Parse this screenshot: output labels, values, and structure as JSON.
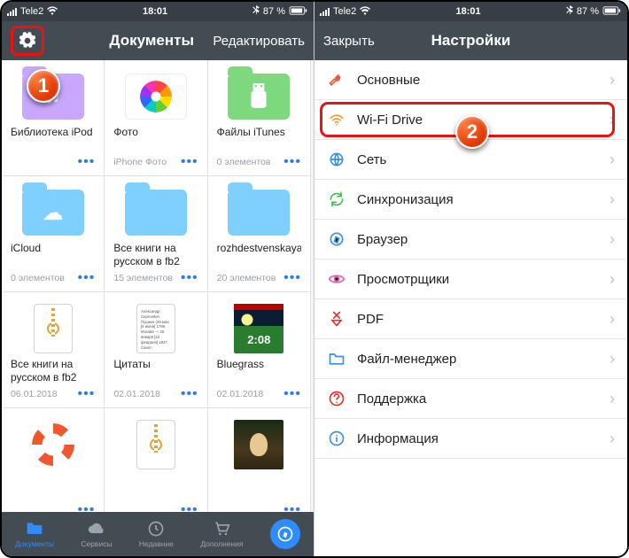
{
  "status": {
    "carrier": "Tele2",
    "time": "18:01",
    "right": "87 %"
  },
  "left_nav": {
    "title": "Документы",
    "edit": "Редактировать"
  },
  "docs": [
    {
      "title": "Библиотека iPod",
      "meta": "",
      "kind": "folder",
      "color": "#c9a7ff",
      "icon": "♫"
    },
    {
      "title": "Фото",
      "meta": "iPhone Фото",
      "kind": "photos"
    },
    {
      "title": "Файлы iTunes",
      "meta": "0 элементов",
      "kind": "folder",
      "color": "#7ed97e",
      "icon": "usb"
    },
    {
      "title": "iCloud",
      "meta": "0 элементов",
      "kind": "folder",
      "color": "#7fd0ff",
      "icon": "☁"
    },
    {
      "title": "Все книги на русском в fb2",
      "meta": "15 элементов",
      "kind": "folder",
      "color": "#7fd0ff",
      "icon": ""
    },
    {
      "title": "rozhdestvenskaya_m...ev.net)",
      "meta": "20 элементов",
      "kind": "folder",
      "color": "#7fd0ff",
      "icon": ""
    },
    {
      "title": "Все книги на русском в fb2",
      "meta": "06.01.2018",
      "kind": "zip"
    },
    {
      "title": "Цитаты",
      "meta": "02.01.2018",
      "kind": "doc",
      "text": "Александр Сергеевич Пушкин (26 мая [6 июня] 1799, Москва — 29 января [10 февраля] 1837, Санкт-"
    },
    {
      "title": "Bluegrass",
      "meta": "02.01.2018",
      "kind": "bluegrass",
      "big": "2:08"
    },
    {
      "title": "",
      "meta": "",
      "kind": "lifebuoy"
    },
    {
      "title": "",
      "meta": "",
      "kind": "zip"
    },
    {
      "title": "",
      "meta": "",
      "kind": "mona"
    }
  ],
  "tabs": [
    {
      "label": "Документы",
      "icon": "folder",
      "active": true
    },
    {
      "label": "Сервисы",
      "icon": "cloud"
    },
    {
      "label": "Недавние",
      "icon": "clock"
    },
    {
      "label": "Дополнения",
      "icon": "cart"
    },
    {
      "label": "",
      "icon": "compass",
      "compass": true
    }
  ],
  "right_nav": {
    "close": "Закрыть",
    "title": "Настройки"
  },
  "settings": [
    {
      "label": "Основные",
      "icon": "wrench",
      "color": "#f0572e"
    },
    {
      "label": "Wi-Fi Drive",
      "icon": "wifi",
      "color": "#f39a2c",
      "highlight": true
    },
    {
      "label": "Сеть",
      "icon": "globe",
      "color": "#3a8fe6"
    },
    {
      "label": "Синхронизация",
      "icon": "sync",
      "color": "#3cc24a"
    },
    {
      "label": "Браузер",
      "icon": "compass",
      "color": "#3a8fe6"
    },
    {
      "label": "Просмотрщики",
      "icon": "eye",
      "color": "#e85ca9"
    },
    {
      "label": "PDF",
      "icon": "pdf",
      "color": "#e0332d"
    },
    {
      "label": "Файл-менеджер",
      "icon": "folderline",
      "color": "#3a8fe6"
    },
    {
      "label": "Поддержка",
      "icon": "help",
      "color": "#e0332d"
    },
    {
      "label": "Информация",
      "icon": "info",
      "color": "#3a8fe6"
    }
  ],
  "badges": {
    "one": "1",
    "two": "2"
  }
}
